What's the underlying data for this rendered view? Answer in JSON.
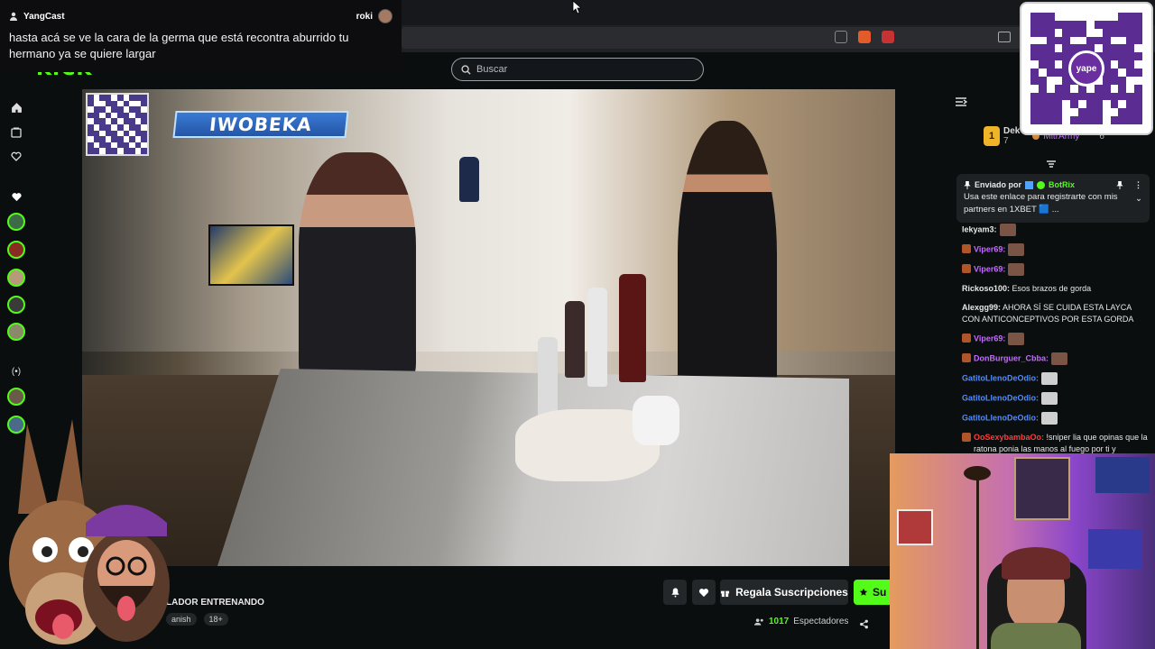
{
  "notification": {
    "channel": "YangCast",
    "user": "roki",
    "message": "hasta acá se ve la cara de la germa que está recontra aburrido tu hermano ya se quiere largar"
  },
  "site": {
    "logo": "KICK",
    "search_placeholder": "Buscar"
  },
  "stream": {
    "overlay_banner": "IWOBEKA",
    "title_fragment": "LADOR ENTRENANDO",
    "language_fragment": "anish",
    "age_tag": "18+",
    "viewers_count": "1017",
    "viewers_label": "Espectadores",
    "gift_button": "Regala Suscripciones",
    "subscribe_fragment": "Su"
  },
  "chat": {
    "leaderboard": [
      {
        "name": "Dek",
        "count": "7"
      },
      {
        "name": "MitrArmy",
        "count": "6"
      }
    ],
    "pinned": {
      "sent_by_label": "Enviado por",
      "sender": "BotRix",
      "text": "Usa este enlace para registrarte con mis partners en 1XBET 🟦 ..."
    },
    "messages": [
      {
        "user": "lekyam3:",
        "text": "",
        "color": "#e8e8e8",
        "emote": "face"
      },
      {
        "user": "Viper69:",
        "text": "",
        "color": "#c26bff",
        "emote": "face"
      },
      {
        "user": "Viper69:",
        "text": "",
        "color": "#c26bff",
        "emote": "face"
      },
      {
        "user": "Rickoso100:",
        "text": "Esos brazos de gorda",
        "color": "#e8e8e8",
        "emote": ""
      },
      {
        "user": "Alexgg99:",
        "text": "AHORA SÍ SE CUIDA ESTA LAYCA CON ANTICONCEPTIVOS POR ESTA GORDA",
        "color": "#e8e8e8",
        "emote": ""
      },
      {
        "user": "Viper69:",
        "text": "",
        "color": "#c26bff",
        "emote": "face"
      },
      {
        "user": "DonBurguer_Cbba:",
        "text": "",
        "color": "#c26bff",
        "emote": "face"
      },
      {
        "user": "GatitoLlenoDeOdio:",
        "text": "",
        "color": "#4f8cff",
        "emote": "cat"
      },
      {
        "user": "GatitoLlenoDeOdio:",
        "text": "",
        "color": "#4f8cff",
        "emote": "cat"
      },
      {
        "user": "GatitoLlenoDeOdio:",
        "text": "",
        "color": "#4f8cff",
        "emote": "cat"
      },
      {
        "user": "OoSexybambaOo:",
        "text": "!sniper lia que opinas que la ratona ponia las manos al fuego por ti y",
        "color": "#ff3b3b",
        "emote": ""
      }
    ],
    "qr_label": "yape"
  },
  "colors": {
    "accent": "#53fc18",
    "background": "#0b0e0f",
    "panel": "#24272a"
  }
}
